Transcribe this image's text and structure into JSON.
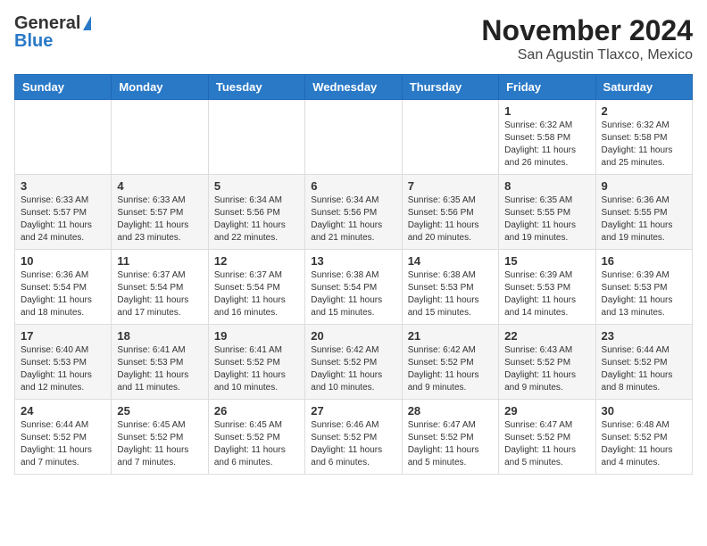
{
  "header": {
    "logo_general": "General",
    "logo_blue": "Blue",
    "month_title": "November 2024",
    "location": "San Agustin Tlaxco, Mexico"
  },
  "days_of_week": [
    "Sunday",
    "Monday",
    "Tuesday",
    "Wednesday",
    "Thursday",
    "Friday",
    "Saturday"
  ],
  "weeks": [
    [
      {
        "day": "",
        "info": ""
      },
      {
        "day": "",
        "info": ""
      },
      {
        "day": "",
        "info": ""
      },
      {
        "day": "",
        "info": ""
      },
      {
        "day": "",
        "info": ""
      },
      {
        "day": "1",
        "info": "Sunrise: 6:32 AM\nSunset: 5:58 PM\nDaylight: 11 hours and 26 minutes."
      },
      {
        "day": "2",
        "info": "Sunrise: 6:32 AM\nSunset: 5:58 PM\nDaylight: 11 hours and 25 minutes."
      }
    ],
    [
      {
        "day": "3",
        "info": "Sunrise: 6:33 AM\nSunset: 5:57 PM\nDaylight: 11 hours and 24 minutes."
      },
      {
        "day": "4",
        "info": "Sunrise: 6:33 AM\nSunset: 5:57 PM\nDaylight: 11 hours and 23 minutes."
      },
      {
        "day": "5",
        "info": "Sunrise: 6:34 AM\nSunset: 5:56 PM\nDaylight: 11 hours and 22 minutes."
      },
      {
        "day": "6",
        "info": "Sunrise: 6:34 AM\nSunset: 5:56 PM\nDaylight: 11 hours and 21 minutes."
      },
      {
        "day": "7",
        "info": "Sunrise: 6:35 AM\nSunset: 5:56 PM\nDaylight: 11 hours and 20 minutes."
      },
      {
        "day": "8",
        "info": "Sunrise: 6:35 AM\nSunset: 5:55 PM\nDaylight: 11 hours and 19 minutes."
      },
      {
        "day": "9",
        "info": "Sunrise: 6:36 AM\nSunset: 5:55 PM\nDaylight: 11 hours and 19 minutes."
      }
    ],
    [
      {
        "day": "10",
        "info": "Sunrise: 6:36 AM\nSunset: 5:54 PM\nDaylight: 11 hours and 18 minutes."
      },
      {
        "day": "11",
        "info": "Sunrise: 6:37 AM\nSunset: 5:54 PM\nDaylight: 11 hours and 17 minutes."
      },
      {
        "day": "12",
        "info": "Sunrise: 6:37 AM\nSunset: 5:54 PM\nDaylight: 11 hours and 16 minutes."
      },
      {
        "day": "13",
        "info": "Sunrise: 6:38 AM\nSunset: 5:54 PM\nDaylight: 11 hours and 15 minutes."
      },
      {
        "day": "14",
        "info": "Sunrise: 6:38 AM\nSunset: 5:53 PM\nDaylight: 11 hours and 15 minutes."
      },
      {
        "day": "15",
        "info": "Sunrise: 6:39 AM\nSunset: 5:53 PM\nDaylight: 11 hours and 14 minutes."
      },
      {
        "day": "16",
        "info": "Sunrise: 6:39 AM\nSunset: 5:53 PM\nDaylight: 11 hours and 13 minutes."
      }
    ],
    [
      {
        "day": "17",
        "info": "Sunrise: 6:40 AM\nSunset: 5:53 PM\nDaylight: 11 hours and 12 minutes."
      },
      {
        "day": "18",
        "info": "Sunrise: 6:41 AM\nSunset: 5:53 PM\nDaylight: 11 hours and 11 minutes."
      },
      {
        "day": "19",
        "info": "Sunrise: 6:41 AM\nSunset: 5:52 PM\nDaylight: 11 hours and 10 minutes."
      },
      {
        "day": "20",
        "info": "Sunrise: 6:42 AM\nSunset: 5:52 PM\nDaylight: 11 hours and 10 minutes."
      },
      {
        "day": "21",
        "info": "Sunrise: 6:42 AM\nSunset: 5:52 PM\nDaylight: 11 hours and 9 minutes."
      },
      {
        "day": "22",
        "info": "Sunrise: 6:43 AM\nSunset: 5:52 PM\nDaylight: 11 hours and 9 minutes."
      },
      {
        "day": "23",
        "info": "Sunrise: 6:44 AM\nSunset: 5:52 PM\nDaylight: 11 hours and 8 minutes."
      }
    ],
    [
      {
        "day": "24",
        "info": "Sunrise: 6:44 AM\nSunset: 5:52 PM\nDaylight: 11 hours and 7 minutes."
      },
      {
        "day": "25",
        "info": "Sunrise: 6:45 AM\nSunset: 5:52 PM\nDaylight: 11 hours and 7 minutes."
      },
      {
        "day": "26",
        "info": "Sunrise: 6:45 AM\nSunset: 5:52 PM\nDaylight: 11 hours and 6 minutes."
      },
      {
        "day": "27",
        "info": "Sunrise: 6:46 AM\nSunset: 5:52 PM\nDaylight: 11 hours and 6 minutes."
      },
      {
        "day": "28",
        "info": "Sunrise: 6:47 AM\nSunset: 5:52 PM\nDaylight: 11 hours and 5 minutes."
      },
      {
        "day": "29",
        "info": "Sunrise: 6:47 AM\nSunset: 5:52 PM\nDaylight: 11 hours and 5 minutes."
      },
      {
        "day": "30",
        "info": "Sunrise: 6:48 AM\nSunset: 5:52 PM\nDaylight: 11 hours and 4 minutes."
      }
    ]
  ]
}
